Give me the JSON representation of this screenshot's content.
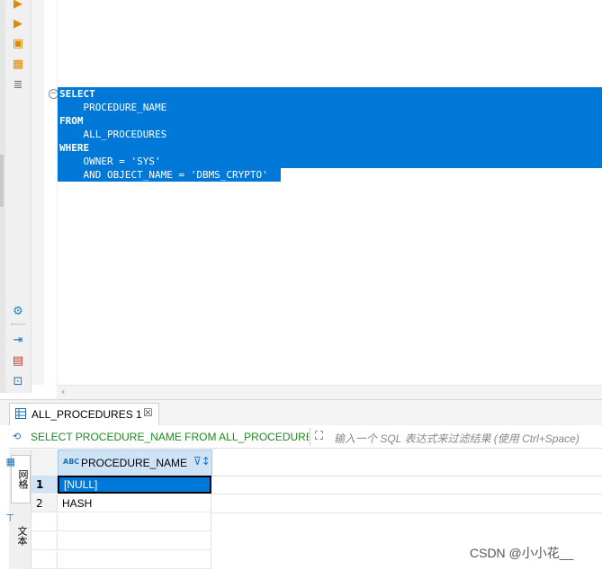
{
  "editor": {
    "lines": [
      {
        "kw": "SELECT",
        "text": ""
      },
      {
        "kw": "",
        "text": "    PROCEDURE_NAME"
      },
      {
        "kw": "FROM",
        "text": ""
      },
      {
        "kw": "",
        "text": "    ALL_PROCEDURES"
      },
      {
        "kw": "WHERE",
        "text": ""
      },
      {
        "kw": "",
        "text": "    OWNER = 'SYS'"
      },
      {
        "kw": "",
        "text": "    AND OBJECT_NAME = 'DBMS_CRYPTO'"
      }
    ]
  },
  "results": {
    "tab_label": "ALL_PROCEDURES 1",
    "sql_text": "SELECT PROCEDURE_NAME FROM ALL_PROCEDURES WHERE OWNER = 'SYS' AND OBJECT_NAME = 'DBMS_CRYPTO'",
    "filter_placeholder": "输入一个 SQL 表达式来过滤结果 (使用 Ctrl+Space)",
    "side_tabs": {
      "grid": "网格",
      "text": "文本"
    },
    "column_type": "ABC",
    "columns": [
      "PROCEDURE_NAME"
    ],
    "rows": [
      {
        "num": "1",
        "value": "[NULL]"
      },
      {
        "num": "2",
        "value": "HASH"
      }
    ]
  },
  "watermark": "CSDN @小小花__",
  "colors": {
    "selection": "#0078d7",
    "sql_green": "#1e8a20",
    "header_blue": "#cfe3f7"
  }
}
